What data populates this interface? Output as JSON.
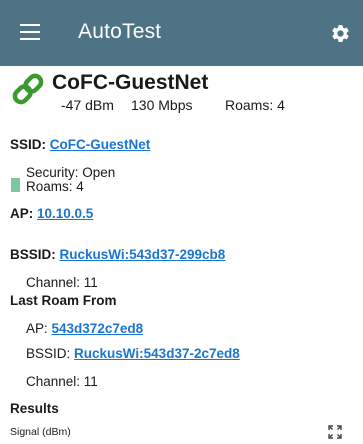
{
  "header": {
    "menu_icon": "hamburger-menu-icon",
    "title": "AutoTest",
    "settings_icon": "gear-icon",
    "color": "#4d7384"
  },
  "network": {
    "icon": "link-icon",
    "icon_color": "#3a9a2e",
    "name": "CoFC-GuestNet",
    "signal": "-47 dBm",
    "rate": "130 Mbps",
    "roams": "Roams: 4"
  },
  "ssid": {
    "label": "SSID:",
    "value": "CoFC-GuestNet",
    "security": "Security: Open",
    "roams": "Roams: 4",
    "roam_indicator_color": "#7cc9a0"
  },
  "ap": {
    "label": "AP:",
    "value": "10.10.0.5"
  },
  "bssid": {
    "label": "BSSID:",
    "value": "RuckusWi:543d37-299cb8",
    "channel": "Channel: 11"
  },
  "last_roam": {
    "heading": "Last Roam From",
    "ap_label": "AP:",
    "ap_value": "543d372c7ed8",
    "bssid_label": "BSSID:",
    "bssid_value": "RuckusWi:543d37-2c7ed8",
    "channel": "Channel: 11"
  },
  "results": {
    "heading": "Results",
    "signal_label": "Signal (dBm)",
    "expand_icon": "expand-icon"
  }
}
